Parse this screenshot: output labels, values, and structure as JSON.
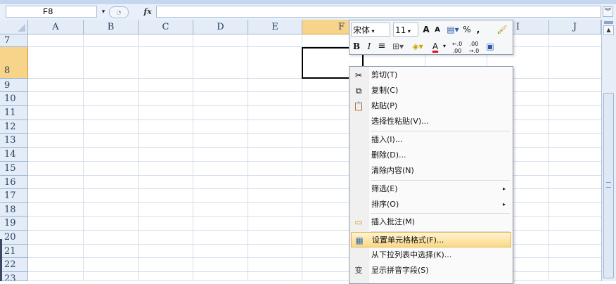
{
  "formula_bar": {
    "name_box": "F8",
    "name_box_dropdown": "▾",
    "fx_label": "fx",
    "expand": "¥"
  },
  "columns": [
    "A",
    "B",
    "C",
    "D",
    "E",
    "F",
    "G",
    "H",
    "I",
    "J"
  ],
  "rows": [
    "7",
    "8",
    "9",
    "10",
    "11",
    "12",
    "13",
    "14",
    "15",
    "16",
    "17",
    "18",
    "19",
    "20",
    "21",
    "22",
    "23"
  ],
  "selected_cell": "F8",
  "mini_toolbar": {
    "font": "宋体",
    "size": "11",
    "grow_font": "A",
    "shrink_font": "A",
    "percent": "%",
    "comma": ",",
    "bold": "B",
    "italic": "I",
    "align": "≡",
    "font_color_letter": "A",
    "inc_decimal": "←.0 .00",
    "dec_decimal": ".00 →.0",
    "icons": [
      "format-painter-icon",
      "borders-icon",
      "fill-color-icon",
      "merge-cells-icon",
      "accounting-format-icon"
    ]
  },
  "context_menu": {
    "items": [
      {
        "label": "剪切(T)",
        "icon": "✂"
      },
      {
        "label": "复制(C)",
        "icon": "⧉"
      },
      {
        "label": "粘贴(P)",
        "icon": "📋"
      },
      {
        "label": "选择性粘贴(V)...",
        "icon": ""
      },
      {
        "label": "插入(I)...",
        "icon": ""
      },
      {
        "label": "删除(D)...",
        "icon": ""
      },
      {
        "label": "清除内容(N)",
        "icon": ""
      },
      {
        "label": "筛选(E)",
        "icon": ""
      },
      {
        "label": "排序(O)",
        "icon": ""
      },
      {
        "label": "插入批注(M)",
        "icon": "▭"
      },
      {
        "label": "设置单元格格式(F)...",
        "icon": "▦"
      },
      {
        "label": "从下拉列表中选择(K)...",
        "icon": ""
      },
      {
        "label": "显示拼音字段(S)",
        "icon": "变"
      }
    ],
    "submenu_arrow": "▸"
  },
  "colors": {
    "header_bg": "#e4ecf7",
    "selected_header": "#f8d38a",
    "highlight": "#fbd984"
  }
}
